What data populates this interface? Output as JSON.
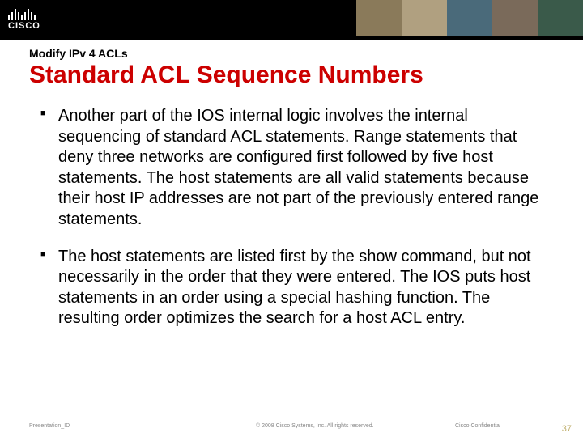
{
  "brand": {
    "logo_text": "CISCO"
  },
  "header": {
    "kicker": "Modify IPv 4 ACLs",
    "title": "Standard ACL Sequence Numbers"
  },
  "bullets": [
    "Another part of the IOS internal logic involves the internal sequencing of standard ACL statements. Range statements that deny three networks are configured first followed by five host statements. The host statements are all valid statements because their host IP addresses are not part of the previously entered range statements.",
    "The host statements are listed first by the show command, but not necessarily in the order that they were entered. The IOS puts host statements in an order using a special hashing function. The resulting order optimizes the search for a host ACL entry."
  ],
  "footer": {
    "presentation_id": "Presentation_ID",
    "copyright": "© 2008 Cisco Systems, Inc. All rights reserved.",
    "confidential": "Cisco Confidential",
    "page_number": "37"
  }
}
